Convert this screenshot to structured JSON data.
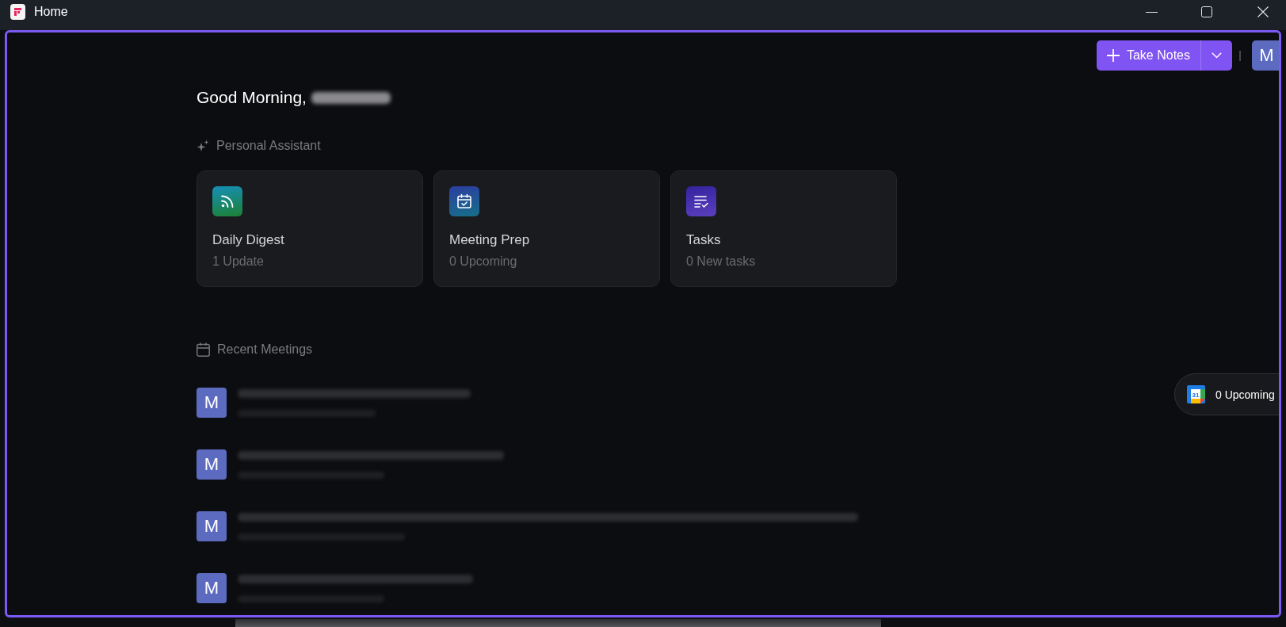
{
  "window": {
    "title": "Home"
  },
  "header": {
    "take_notes": {
      "label": "Take Notes"
    },
    "avatar": "M"
  },
  "greeting": {
    "text": "Good Morning,"
  },
  "personal_assistant": {
    "label": "Personal Assistant",
    "cards": [
      {
        "kind": "digest",
        "title": "Daily Digest",
        "subtitle": "1 Update"
      },
      {
        "kind": "meeting_prep",
        "title": "Meeting Prep",
        "subtitle": "0 Upcoming"
      },
      {
        "kind": "tasks",
        "title": "Tasks",
        "subtitle": "0 New tasks"
      }
    ]
  },
  "recent_meetings": {
    "label": "Recent Meetings",
    "meetings": [
      {
        "avatar": "M"
      },
      {
        "avatar": "M"
      },
      {
        "avatar": "M"
      },
      {
        "avatar": "M"
      }
    ]
  },
  "upcoming_widget": {
    "calendar_day": "31",
    "label": "0 Upcoming"
  }
}
